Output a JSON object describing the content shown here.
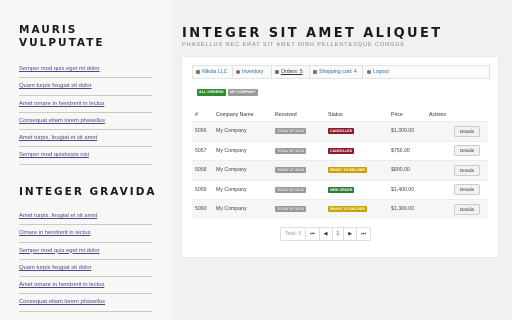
{
  "sidebar": {
    "heading1": "MAURIS VULPUTATE",
    "links1": [
      "Semper mod quis eget mi dolor",
      "Quam turpis feugiat sit dolor",
      "Amet ornare in hendrerit in lectus",
      "Consequat etiam lorem phasellus",
      "Amet turpis, feugiat et sit amet",
      "Semper mod quisturpis nisi"
    ],
    "heading2": "INTEGER GRAVIDA",
    "links2": [
      "Amet turpis, feugiat et sit amet",
      "Ornare in hendrerit in lectus",
      "Semper mod quis eget mi dolor",
      "Quam turpis feugiat sit dolor",
      "Amet ornare in hendrerit in lectus",
      "Consequat etiam lorem phasellus"
    ]
  },
  "main": {
    "title": "INTEGER SIT AMET ALIQUET",
    "subtitle": "PHASELLUS NEC ERAT SIT AMET NIBH PELLENTESQUE CONGUE"
  },
  "nav": {
    "user": "Nikola LLC",
    "inventory": "Inventory",
    "orders": "Orders: 5",
    "cart": "Shopping cart: 4",
    "logout": "Logout"
  },
  "filters": {
    "all": "ALL ORDERS",
    "my": "MY COMPANY"
  },
  "table": {
    "headers": [
      "#",
      "Company Name",
      "Received",
      "Status",
      "Price",
      "Actions"
    ],
    "rows": [
      {
        "id": "5056",
        "company": "My Company",
        "received": "TODAY AT 15:26",
        "status": "CANCELLED",
        "status_color": "#8b1a2b",
        "price": "$1,300.00",
        "action": "Details"
      },
      {
        "id": "5057",
        "company": "My Company",
        "received": "TODAY AT 15:26",
        "status": "CANCELLED",
        "status_color": "#8b1a2b",
        "price": "$756.00",
        "action": "Details"
      },
      {
        "id": "5058",
        "company": "My Company",
        "received": "TODAY AT 15:26",
        "status": "READY TO DELIVER",
        "status_color": "#c9a400",
        "price": "$800.00",
        "action": "Details"
      },
      {
        "id": "5059",
        "company": "My Company",
        "received": "TODAY AT 15:26",
        "status": "NEW ORDER",
        "status_color": "#2e7d32",
        "price": "$1,400.00",
        "action": "Details"
      },
      {
        "id": "5060",
        "company": "My Company",
        "received": "TODAY AT 15:26",
        "status": "READY TO DELIVER",
        "status_color": "#c9a400",
        "price": "$1,300.00",
        "action": "Details"
      }
    ]
  },
  "pager": {
    "total": "Total: 5",
    "first": "⏮",
    "prev": "◀",
    "page": "1",
    "next": "▶",
    "last": "⏭"
  }
}
